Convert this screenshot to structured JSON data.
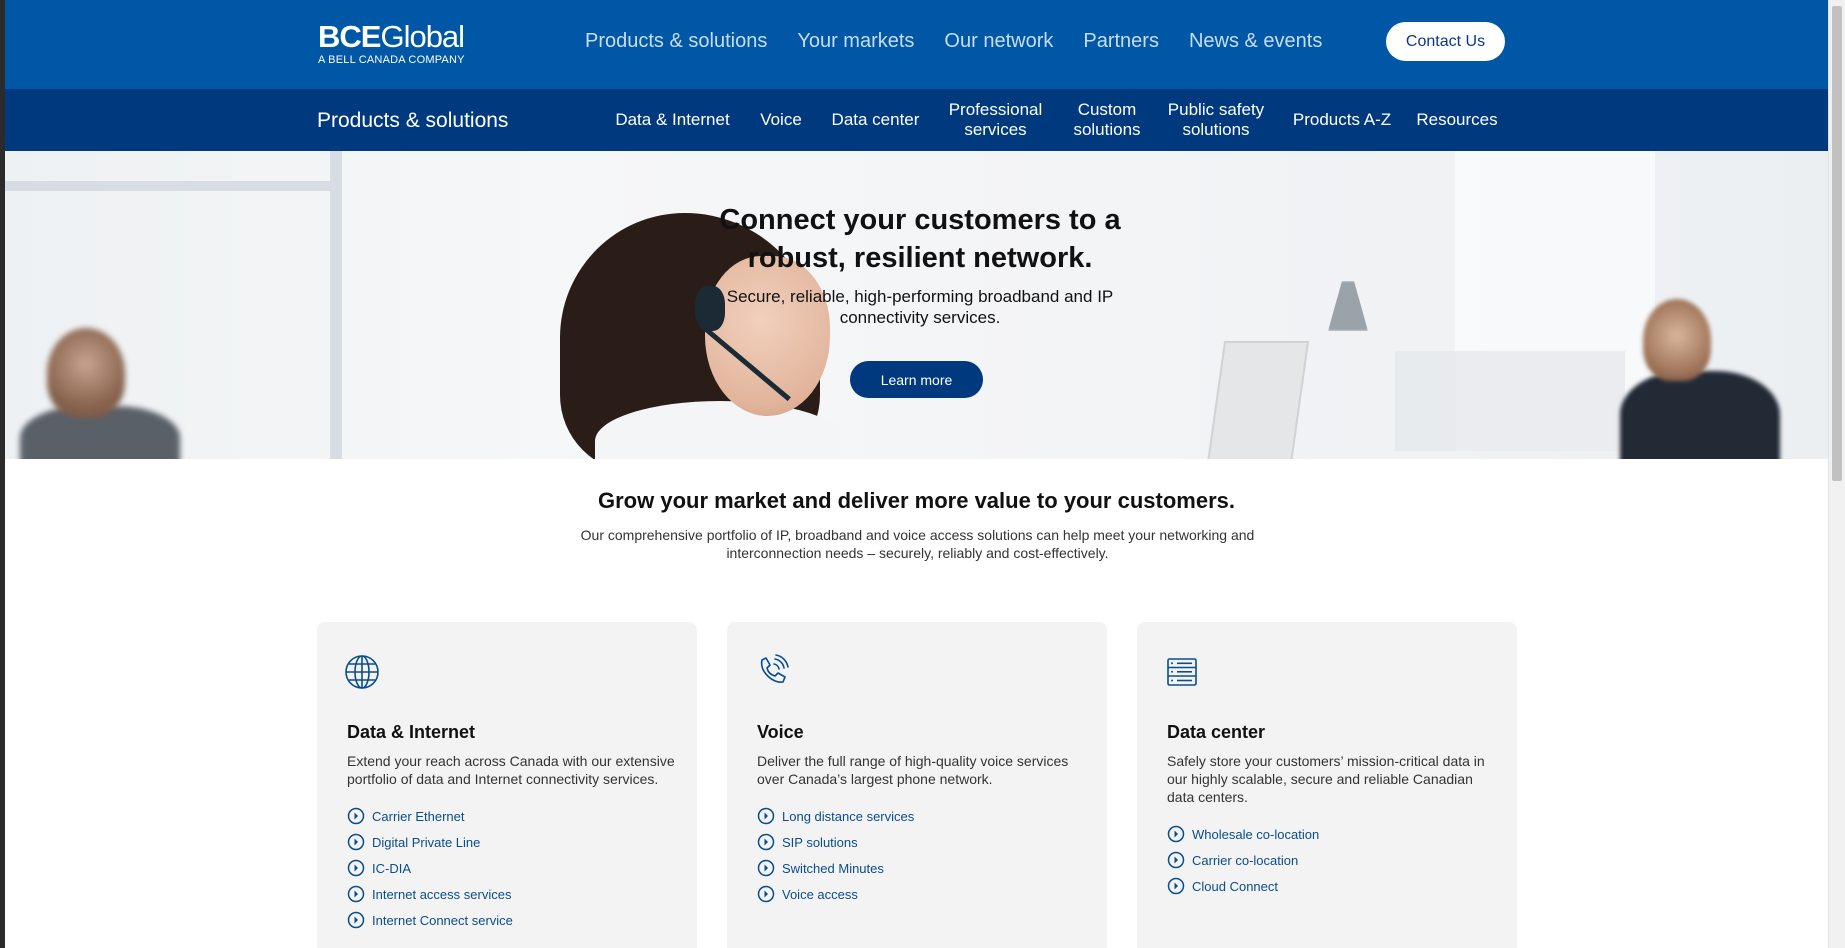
{
  "header": {
    "logo": {
      "brand_bold": "BCE",
      "brand_light": "Global",
      "tagline": "A BELL CANADA COMPANY"
    },
    "nav": [
      "Products & solutions",
      "Your markets",
      "Our network",
      "Partners",
      "News & events"
    ],
    "contact_label": "Contact Us"
  },
  "subnav": {
    "title": "Products & solutions",
    "items": [
      "Data & Internet",
      "Voice",
      "Data center",
      "Professional services",
      "Custom solutions",
      "Public safety solutions",
      "Products A-Z",
      "Resources"
    ]
  },
  "hero": {
    "title": "Connect your customers to a robust, resilient network.",
    "subtitle": "Secure, reliable, high-performing broadband and IP connectivity services.",
    "cta_label": "Learn more"
  },
  "section": {
    "title": "Grow your market and deliver more value to your customers.",
    "description": "Our comprehensive portfolio of IP, broadband and voice access solutions can help meet your networking and interconnection needs – securely, reliably and cost-effectively."
  },
  "cards": [
    {
      "icon": "globe-icon",
      "title": "Data & Internet",
      "description": "Extend your reach across Canada with our extensive portfolio of data and Internet connectivity services.",
      "links": [
        "Carrier Ethernet",
        "Digital Private Line",
        "IC-DIA",
        "Internet access services",
        "Internet Connect service"
      ]
    },
    {
      "icon": "phone-icon",
      "title": "Voice",
      "description": "Deliver the full range of high-quality voice services over Canada’s largest phone network.",
      "links": [
        "Long distance services",
        "SIP solutions",
        "Switched Minutes",
        "Voice access"
      ]
    },
    {
      "icon": "server-icon",
      "title": "Data center",
      "description": "Safely store your customers’ mission-critical data in our highly scalable, secure and reliable Canadian data centers.",
      "links": [
        "Wholesale co-location",
        "Carrier co-location",
        "Cloud Connect"
      ]
    }
  ],
  "colors": {
    "header_blue": "#0057a5",
    "subnav_navy": "#00397e",
    "link_blue": "#0a4d8c",
    "card_bg": "#f3f3f3"
  }
}
